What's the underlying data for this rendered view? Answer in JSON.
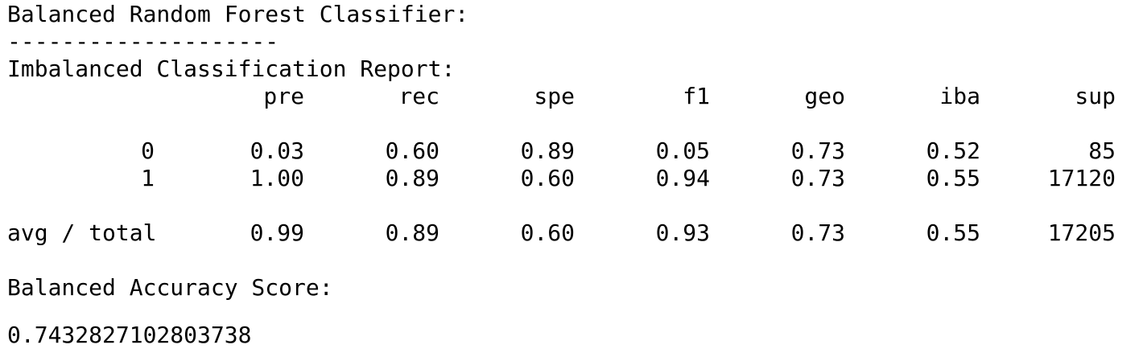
{
  "title": "Balanced Random Forest Classifier:",
  "separator": "--------------------",
  "report_title": "Imbalanced Classification Report:",
  "header": [
    "pre",
    "rec",
    "spe",
    "f1",
    "geo",
    "iba",
    "sup"
  ],
  "rows": [
    {
      "label": "0",
      "values": [
        "0.03",
        "0.60",
        "0.89",
        "0.05",
        "0.73",
        "0.52",
        "85"
      ]
    },
    {
      "label": "1",
      "values": [
        "1.00",
        "0.89",
        "0.60",
        "0.94",
        "0.73",
        "0.55",
        "17120"
      ]
    }
  ],
  "total_row": {
    "label": "avg / total",
    "values": [
      "0.99",
      "0.89",
      "0.60",
      "0.93",
      "0.73",
      "0.55",
      "17205"
    ]
  },
  "accuracy_label": "Balanced Accuracy Score:",
  "accuracy_value": "0.7432827102803738"
}
